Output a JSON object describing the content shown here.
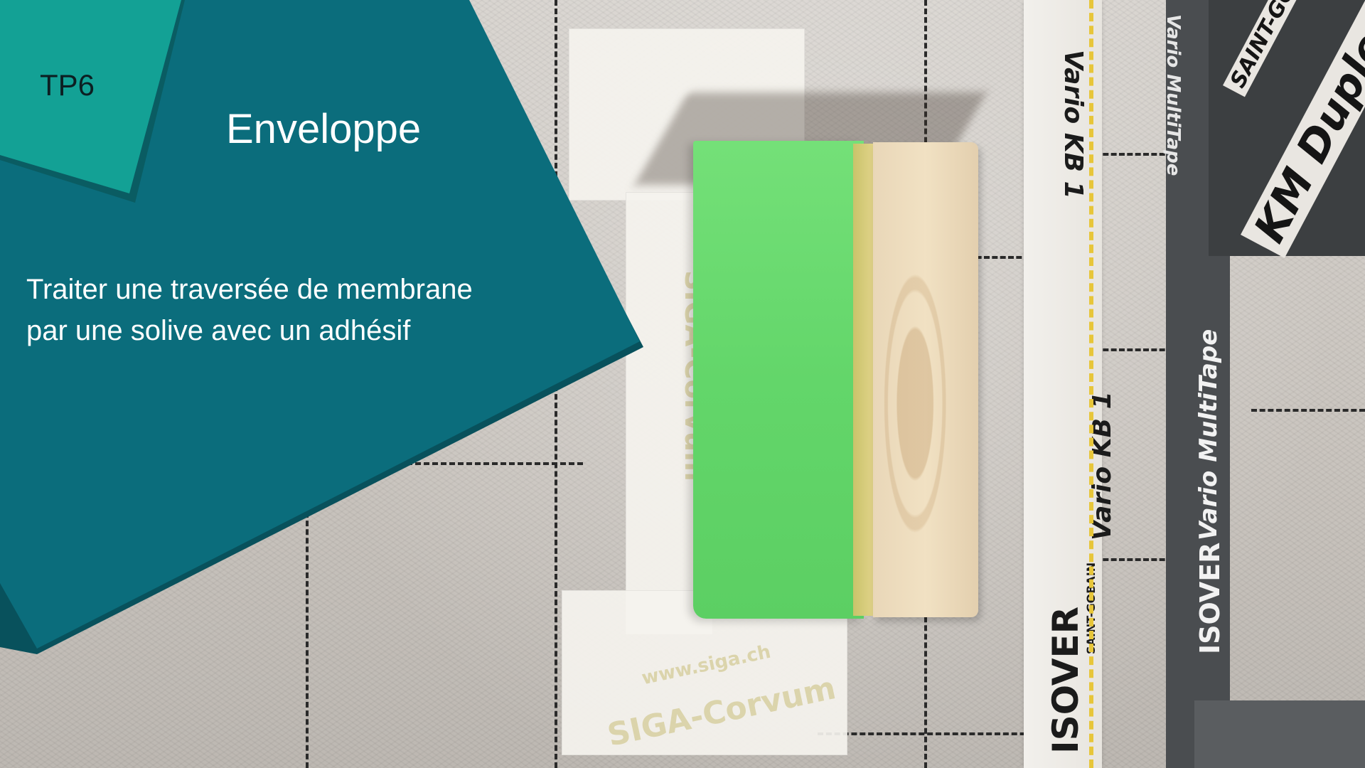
{
  "scene": {
    "photo_subject": "joist-through-membrane",
    "colors": {
      "panel_teal_dark": "#0b6d7c",
      "panel_teal_shadow": "#08515c",
      "badge_teal": "#13a195",
      "badge_shadow": "#0a5c62",
      "tape_green": "#63d66a",
      "tape_yellow_dash": "#e7c63a"
    },
    "visible_print": {
      "tape_left": "Vario KB 1",
      "tape_brand": "ISOVER",
      "tape_brand_sub": "SAINT-GOBAIN",
      "tape_right": "Vario MultiTape",
      "tape_right_brand": "ISOVER",
      "frame_print": "KM Duplex UV",
      "frame_brand": "SAINT-GOBAIN",
      "siga_print": "SIGA-Corvum",
      "siga_url": "www.siga.ch"
    }
  },
  "overlay": {
    "badge": "TP6",
    "title": "Enveloppe",
    "subtitle_line1": "Traiter une traversée de membrane",
    "subtitle_line2": "par une solive avec un adhésif"
  }
}
